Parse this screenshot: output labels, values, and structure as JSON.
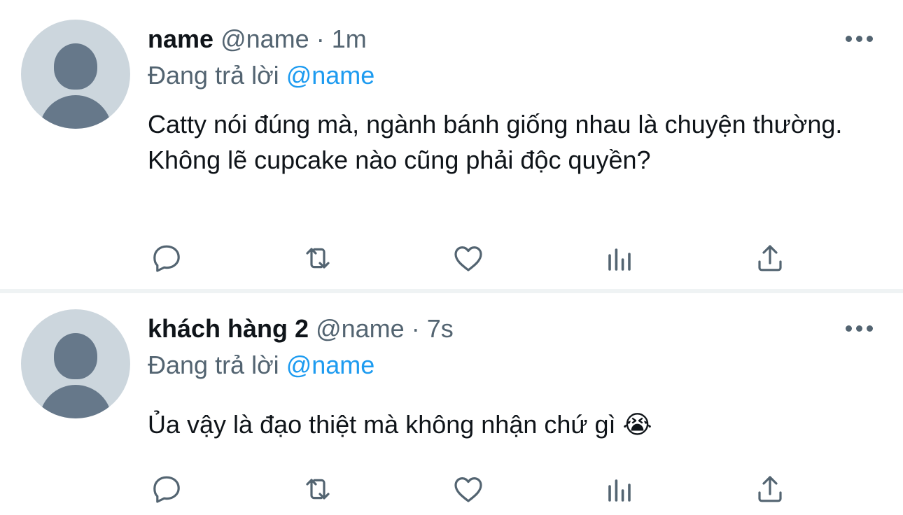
{
  "tweets": [
    {
      "display_name": "name",
      "handle": "@name",
      "separator": "·",
      "time": "1m",
      "replying_prefix": "Đang trả lời",
      "replying_to": "@name",
      "text": "Catty nói đúng mà, ngành bánh giống nhau là chuyện thường. Không lẽ cupcake nào cũng phải độc quyền?",
      "emoji": ""
    },
    {
      "display_name": "khách hàng 2",
      "handle": "@name",
      "separator": "·",
      "time": "7s",
      "replying_prefix": "Đang trả lời",
      "replying_to": "@name",
      "text": "Ủa vậy là đạo thiệt mà không nhận chứ gì ",
      "emoji": "😭"
    }
  ],
  "actions": [
    "reply-icon",
    "retweet-icon",
    "like-icon",
    "analytics-icon",
    "share-icon"
  ],
  "colors": {
    "text": "#0f1419",
    "secondary": "#536471",
    "link": "#1d9bf0",
    "avatar_bg": "#ccd6dd",
    "avatar_fg": "#66788a",
    "divider": "#eff3f4"
  }
}
